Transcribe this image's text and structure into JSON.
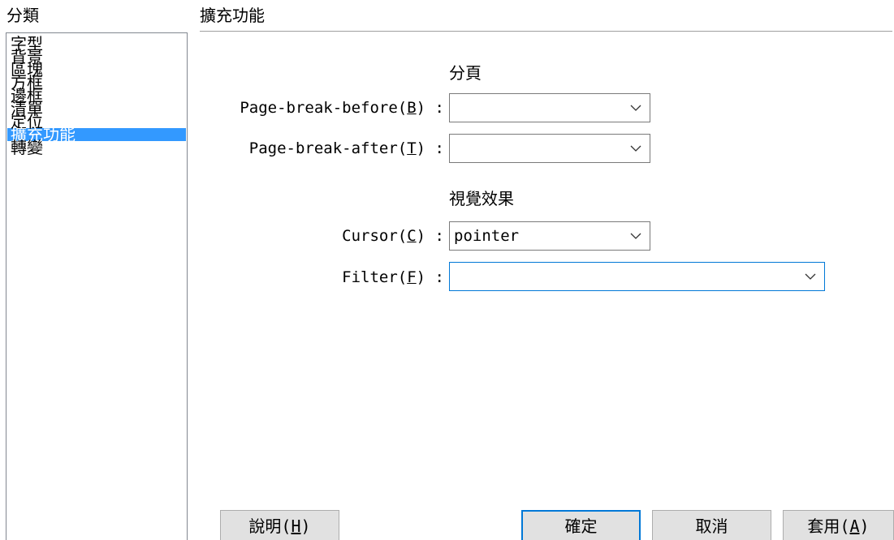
{
  "sidebar": {
    "title": "分類",
    "items": [
      {
        "label": "字型"
      },
      {
        "label": "背景"
      },
      {
        "label": "區塊"
      },
      {
        "label": "方框"
      },
      {
        "label": "邊框"
      },
      {
        "label": "清單"
      },
      {
        "label": "定位"
      },
      {
        "label": "擴充功能",
        "selected": true
      },
      {
        "label": "轉變"
      }
    ]
  },
  "main": {
    "title": "擴充功能",
    "page_break": {
      "heading": "分頁",
      "before": {
        "label_pre": "Page-break-before(",
        "accel": "B",
        "label_post": ") :",
        "value": ""
      },
      "after": {
        "label_pre": "Page-break-after(",
        "accel": "T",
        "label_post": ") :",
        "value": ""
      }
    },
    "visual": {
      "heading": "視覺效果",
      "cursor": {
        "label_pre": "Cursor(",
        "accel": "C",
        "label_post": ") :",
        "value": "pointer"
      },
      "filter": {
        "label_pre": "Filter(",
        "accel": "F",
        "label_post": ") :",
        "value": ""
      }
    }
  },
  "buttons": {
    "help": {
      "label_pre": "說明(",
      "accel": "H",
      "label_post": ")"
    },
    "ok": {
      "label": "確定"
    },
    "cancel": {
      "label": "取消"
    },
    "apply": {
      "label_pre": "套用(",
      "accel": "A",
      "label_post": ")"
    }
  },
  "colors": {
    "selection": "#3399ff",
    "focus_border": "#0078d7",
    "button_face": "#e1e1e1"
  },
  "icons": {
    "dropdown": "chevron-down-icon"
  }
}
